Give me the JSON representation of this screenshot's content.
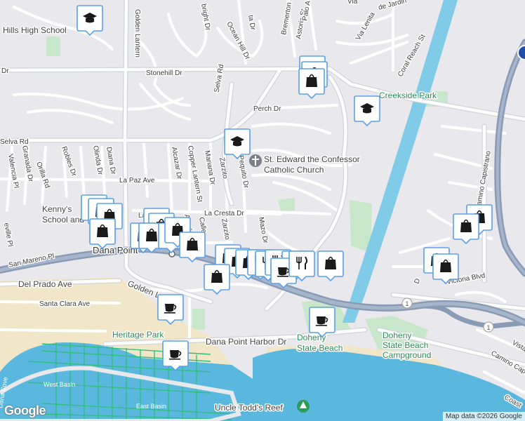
{
  "map": {
    "credit": "Map data ©2026 Google",
    "logo": "Google",
    "labels": {
      "hills_high": "Hills High School",
      "stonehill": "Stonehill Dr",
      "selva_rd_main": "Selva Rd",
      "selva_rd_west": "Selva Rd",
      "golden_lantern": "Golden Lantern",
      "golden_lantern_s": "Golden L",
      "perch": "Perch Dr",
      "creekside": "Creekside Park",
      "st_edward_1": "St. Edward the Confessor",
      "st_edward_2": "Catholic Church",
      "la_paz": "La Paz Ave",
      "la_cresta": "La Cresta Dr",
      "kennys_1": "Kenny's",
      "kennys_2": "School and",
      "dana_point": "Dana Point",
      "san_mareno": "San Mareno Pl",
      "del_prado": "Del Prado Ave",
      "santa_clara": "Santa Clara Ave",
      "heritage": "Heritage Park",
      "harbor_dr": "Dana Point Harbor Dr",
      "doheny_1": "Doheny",
      "doheny_2": "State Beach",
      "doheny_camp_1": "Doheny",
      "doheny_camp_2": "State Beach",
      "doheny_camp_3": "Campground",
      "uncle_todds": "Uncle Todd's Reef",
      "west_basin": "West Basin",
      "east_basin": "East Basin",
      "dana_cove": "Dana Cove",
      "victoria": "Victoria Blvd",
      "camino_cap": "Camino Capistrano",
      "camino_cap_s": "Camino Capis",
      "coral_reach": "Coral Reach St",
      "via_lenita": "Via Lenita",
      "jardin": "de Jardin",
      "bremerton": "Bremerton St",
      "astoria": "Astoria St",
      "palo": "Palo A",
      "ocean_hill": "Ocean Hill Dr",
      "mazo": "Mazo Dr",
      "pequito": "Pequito Dr",
      "zarzito": "Zarzito",
      "zarzito_s": "Zarzito",
      "mariana": "Mariana Dr",
      "copper_lantern": "Copper Lantern St",
      "alcazar": "Alcazar Dr",
      "aurelia": "Aurelia",
      "calle": "Calle",
      "diana": "Diana Dr",
      "diana_2": "Diana Dr",
      "olinda": "Olinda Dr",
      "robles": "Robles Dr",
      "orilla": "Orilla Rd",
      "granada": "Granada Dr",
      "valencia": "Valencia Pl",
      "seville": "eville Pl",
      "ambright": "bright Dr",
      "hwy1_a": "1",
      "hwy1_b": "1",
      "vista": "Vista",
      "coast": "Coast",
      "dr_frag": "Dr",
      "ta_dr": "ta Dr",
      "d_frag": "D",
      "via": "Via",
      "la_c": "La C",
      "l_frag": "L"
    }
  }
}
